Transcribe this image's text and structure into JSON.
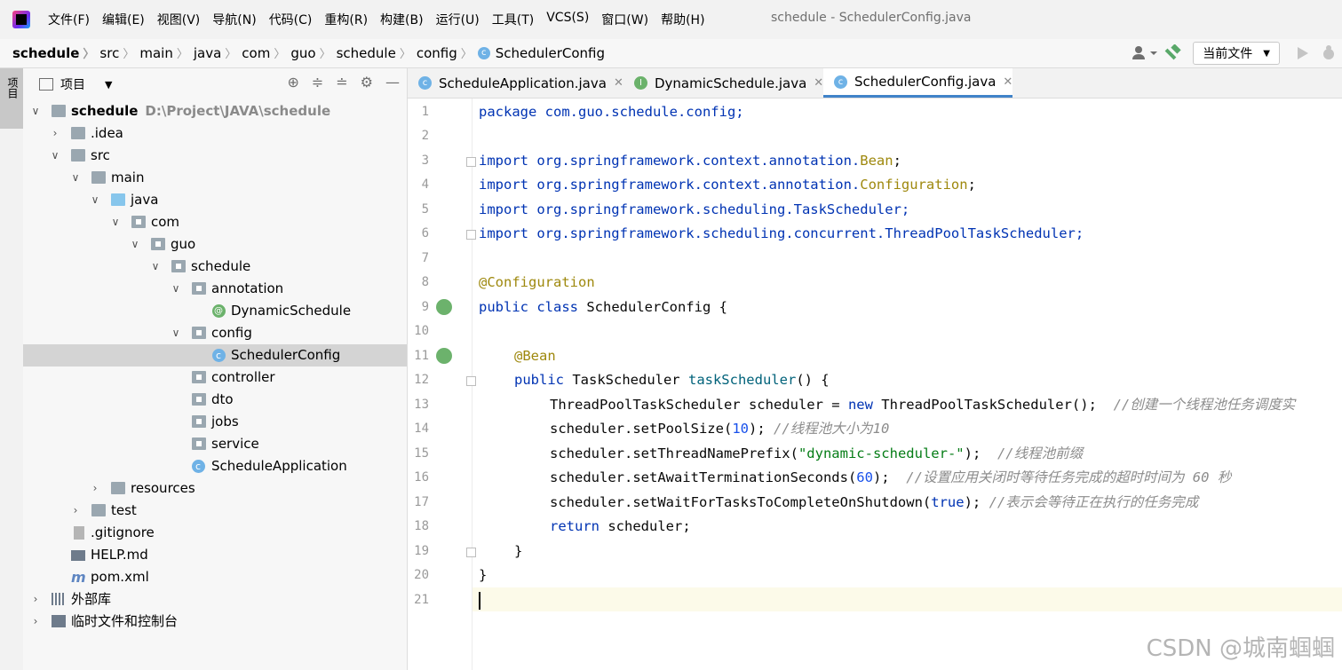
{
  "menu": {
    "items": [
      "文件(F)",
      "编辑(E)",
      "视图(V)",
      "导航(N)",
      "代码(C)",
      "重构(R)",
      "构建(B)",
      "运行(U)",
      "工具(T)",
      "VCS(S)",
      "窗口(W)",
      "帮助(H)"
    ],
    "window_title": "schedule - SchedulerConfig.java"
  },
  "breadcrumbs": [
    "schedule",
    "src",
    "main",
    "java",
    "com",
    "guo",
    "schedule",
    "config",
    "SchedulerConfig"
  ],
  "toolbar": {
    "run_config": "当前文件"
  },
  "left_tool": {
    "project_tab": "项目"
  },
  "project_panel": {
    "title": "项目",
    "tree": [
      {
        "label": "schedule",
        "path": "D:\\Project\\JAVA\\schedule"
      },
      {
        "label": ".idea"
      },
      {
        "label": "src"
      },
      {
        "label": "main"
      },
      {
        "label": "java"
      },
      {
        "label": "com"
      },
      {
        "label": "guo"
      },
      {
        "label": "schedule"
      },
      {
        "label": "annotation"
      },
      {
        "label": "DynamicSchedule"
      },
      {
        "label": "config"
      },
      {
        "label": "SchedulerConfig"
      },
      {
        "label": "controller"
      },
      {
        "label": "dto"
      },
      {
        "label": "jobs"
      },
      {
        "label": "service"
      },
      {
        "label": "ScheduleApplication"
      },
      {
        "label": "resources"
      },
      {
        "label": "test"
      },
      {
        "label": ".gitignore"
      },
      {
        "label": "HELP.md"
      },
      {
        "label": "pom.xml"
      },
      {
        "label": "外部库"
      },
      {
        "label": "临时文件和控制台"
      }
    ]
  },
  "tabs": [
    {
      "label": "ScheduleApplication.java"
    },
    {
      "label": "DynamicSchedule.java"
    },
    {
      "label": "SchedulerConfig.java"
    }
  ],
  "editor": {
    "line_numbers": [
      "1",
      "2",
      "3",
      "4",
      "5",
      "6",
      "7",
      "8",
      "9",
      "10",
      "11",
      "12",
      "13",
      "14",
      "15",
      "16",
      "17",
      "18",
      "19",
      "20",
      "21"
    ],
    "lines": {
      "l1": "package com.guo.schedule.config;",
      "l3a": "import org.springframework.context.annotation.",
      "l3b": "Bean",
      "l3c": ";",
      "l4a": "import org.springframework.context.annotation.",
      "l4b": "Configuration",
      "l4c": ";",
      "l5": "import org.springframework.scheduling.TaskScheduler;",
      "l6": "import org.springframework.scheduling.concurrent.ThreadPoolTaskScheduler;",
      "l8": "@Configuration",
      "l9a": "public class ",
      "l9b": "SchedulerConfig {",
      "l11": "@Bean",
      "l12a": "public ",
      "l12b": "TaskScheduler ",
      "l12c": "taskScheduler",
      "l12d": "() {",
      "l13a": "ThreadPoolTaskScheduler scheduler = ",
      "l13b": "new",
      "l13c": " ThreadPoolTaskScheduler();  ",
      "l13d": "//创建一个线程池任务调度实",
      "l14a": "scheduler.setPoolSize(",
      "l14b": "10",
      "l14c": "); ",
      "l14d": "//线程池大小为10",
      "l15a": "scheduler.setThreadNamePrefix(",
      "l15b": "\"dynamic-scheduler-\"",
      "l15c": ");  ",
      "l15d": "//线程池前缀",
      "l16a": "scheduler.setAwaitTerminationSeconds(",
      "l16b": "60",
      "l16c": ");  ",
      "l16d": "//设置应用关闭时等待任务完成的超时时间为 60 秒",
      "l17a": "scheduler.setWaitForTasksToCompleteOnShutdown(",
      "l17b": "true",
      "l17c": "); ",
      "l17d": "//表示会等待正在执行的任务完成",
      "l18a": "return",
      "l18b": " scheduler;",
      "l19": "}",
      "l20": "}"
    }
  },
  "watermark": "CSDN @城南蝈蝈"
}
